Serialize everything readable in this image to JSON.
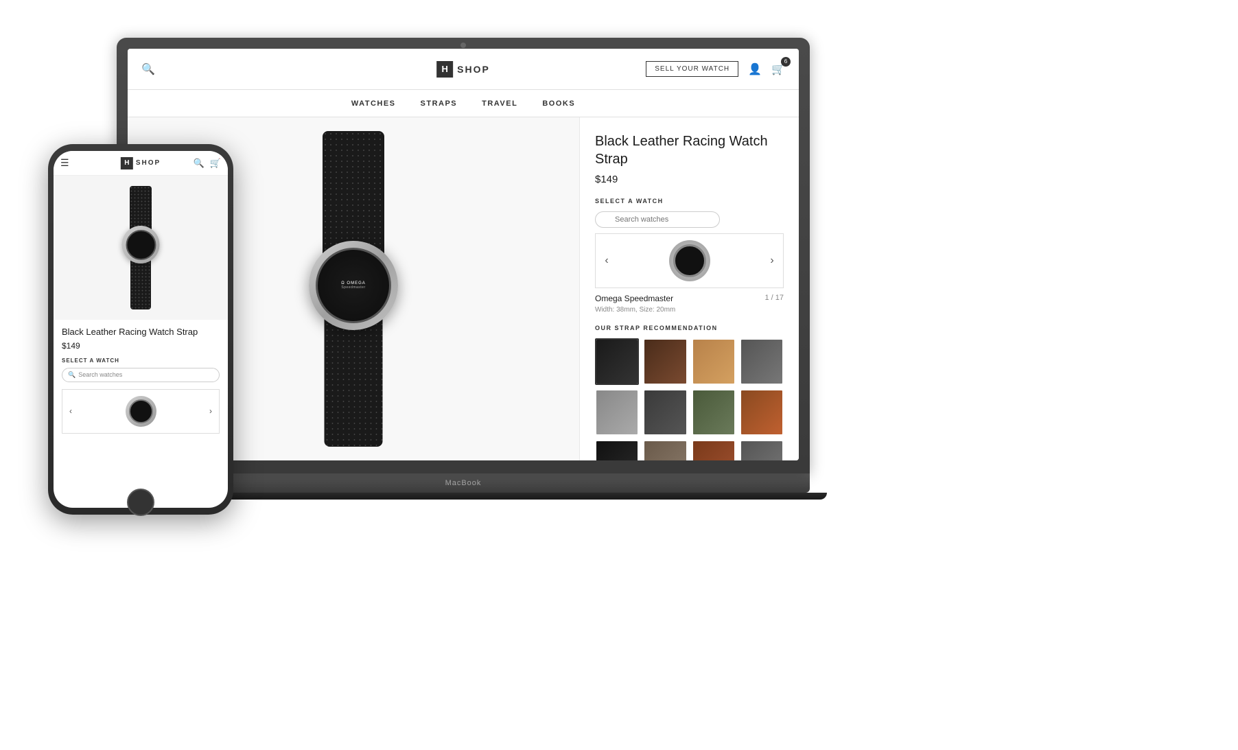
{
  "scene": {
    "background": "#f0f0f0"
  },
  "laptop": {
    "macbook_label": "MacBook"
  },
  "website": {
    "header": {
      "logo_letter": "H",
      "logo_text": "SHOP",
      "sell_watch_btn": "SELL YOUR WATCH",
      "cart_count": "6"
    },
    "nav": {
      "items": [
        {
          "label": "WATCHES"
        },
        {
          "label": "STRAPS"
        },
        {
          "label": "TRAVEL"
        },
        {
          "label": "BOOKS"
        }
      ]
    },
    "product": {
      "title": "Black Leather Racing Watch Strap",
      "price": "$149",
      "select_watch_label": "SELECT A WATCH",
      "search_watches_placeholder": "Search watches",
      "watch_name": "Omega Speedmaster",
      "watch_counter": "1 / 17",
      "watch_specs": "Width: 38mm, Size: 20mm",
      "strap_recommendation_label": "OUR STRAP RECOMMENDATION",
      "carousel_prev": "‹",
      "carousel_next": "›"
    }
  },
  "phone": {
    "header": {
      "logo_letter": "H",
      "logo_text": "SHOP"
    },
    "product": {
      "title": "Black Leather Racing Watch Strap",
      "price": "$149",
      "select_watch_label": "SELECT A WATCH",
      "search_placeholder": "Search watches",
      "carousel_prev": "‹",
      "carousel_next": "›"
    }
  },
  "straps": [
    {
      "id": 1,
      "color": "black",
      "selected": true
    },
    {
      "id": 2,
      "color": "dark-brown"
    },
    {
      "id": 3,
      "color": "tan"
    },
    {
      "id": 4,
      "color": "dark-gray"
    },
    {
      "id": 5,
      "color": "gray"
    },
    {
      "id": 6,
      "color": "charcoal"
    },
    {
      "id": 7,
      "color": "olive"
    },
    {
      "id": 8,
      "color": "cognac"
    },
    {
      "id": 9,
      "color": "black2"
    },
    {
      "id": 10,
      "color": "taupe"
    },
    {
      "id": 11,
      "color": "brown2"
    },
    {
      "id": 12,
      "color": "dark-gray2"
    }
  ]
}
